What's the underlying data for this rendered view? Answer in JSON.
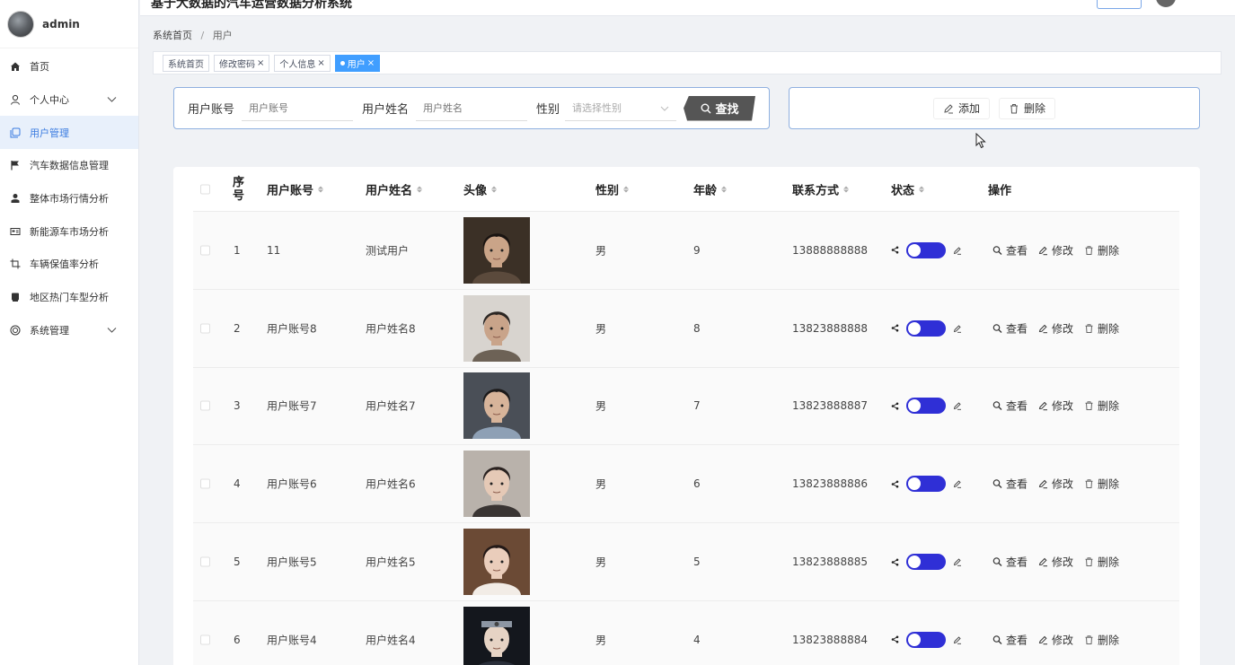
{
  "app": {
    "title": "基于大数据的汽车运营数据分析系统"
  },
  "sidebar": {
    "user_name": "admin",
    "items": [
      {
        "label": "首页",
        "icon": "home-icon"
      },
      {
        "label": "个人中心",
        "icon": "user-icon",
        "expandable": true
      },
      {
        "label": "用户管理",
        "icon": "copy-icon",
        "active": true
      },
      {
        "label": "汽车数据信息管理",
        "icon": "flag-icon"
      },
      {
        "label": "整体市场行情分析",
        "icon": "person-icon"
      },
      {
        "label": "新能源车市场分析",
        "icon": "card-icon"
      },
      {
        "label": "车辆保值率分析",
        "icon": "crop-icon"
      },
      {
        "label": "地区热门车型分析",
        "icon": "printer-icon"
      },
      {
        "label": "系统管理",
        "icon": "settings-icon",
        "expandable": true
      }
    ]
  },
  "breadcrumb": {
    "home": "系统首页",
    "separator": "/",
    "current": "用户"
  },
  "tags": [
    {
      "label": "系统首页",
      "closable": false
    },
    {
      "label": "修改密码",
      "closable": true
    },
    {
      "label": "个人信息",
      "closable": true
    },
    {
      "label": "用户",
      "closable": true,
      "active": true
    }
  ],
  "search": {
    "account_label": "用户账号",
    "account_placeholder": "用户账号",
    "name_label": "用户姓名",
    "name_placeholder": "用户姓名",
    "gender_label": "性别",
    "gender_placeholder": "请选择性别",
    "search_button": "查找"
  },
  "actions": {
    "add_label": "添加",
    "delete_label": "删除"
  },
  "table": {
    "columns": {
      "index": "序号",
      "account": "用户账号",
      "name": "用户姓名",
      "avatar": "头像",
      "gender": "性别",
      "age": "年龄",
      "phone": "联系方式",
      "status": "状态",
      "operation": "操作"
    },
    "op_view": "查看",
    "op_edit": "修改",
    "op_delete": "删除",
    "rows": [
      {
        "index": "1",
        "account": "11",
        "name": "测试用户",
        "gender": "男",
        "age": "9",
        "phone": "13888888888"
      },
      {
        "index": "2",
        "account": "用户账号8",
        "name": "用户姓名8",
        "gender": "男",
        "age": "8",
        "phone": "13823888888"
      },
      {
        "index": "3",
        "account": "用户账号7",
        "name": "用户姓名7",
        "gender": "男",
        "age": "7",
        "phone": "13823888887"
      },
      {
        "index": "4",
        "account": "用户账号6",
        "name": "用户姓名6",
        "gender": "男",
        "age": "6",
        "phone": "13823888886"
      },
      {
        "index": "5",
        "account": "用户账号5",
        "name": "用户姓名5",
        "gender": "男",
        "age": "5",
        "phone": "13823888885"
      },
      {
        "index": "6",
        "account": "用户账号4",
        "name": "用户姓名4",
        "gender": "男",
        "age": "4",
        "phone": "13823888884"
      }
    ]
  },
  "colors": {
    "accent": "#409eff",
    "toggle": "#2f2fd6",
    "search_button": "#555555"
  }
}
